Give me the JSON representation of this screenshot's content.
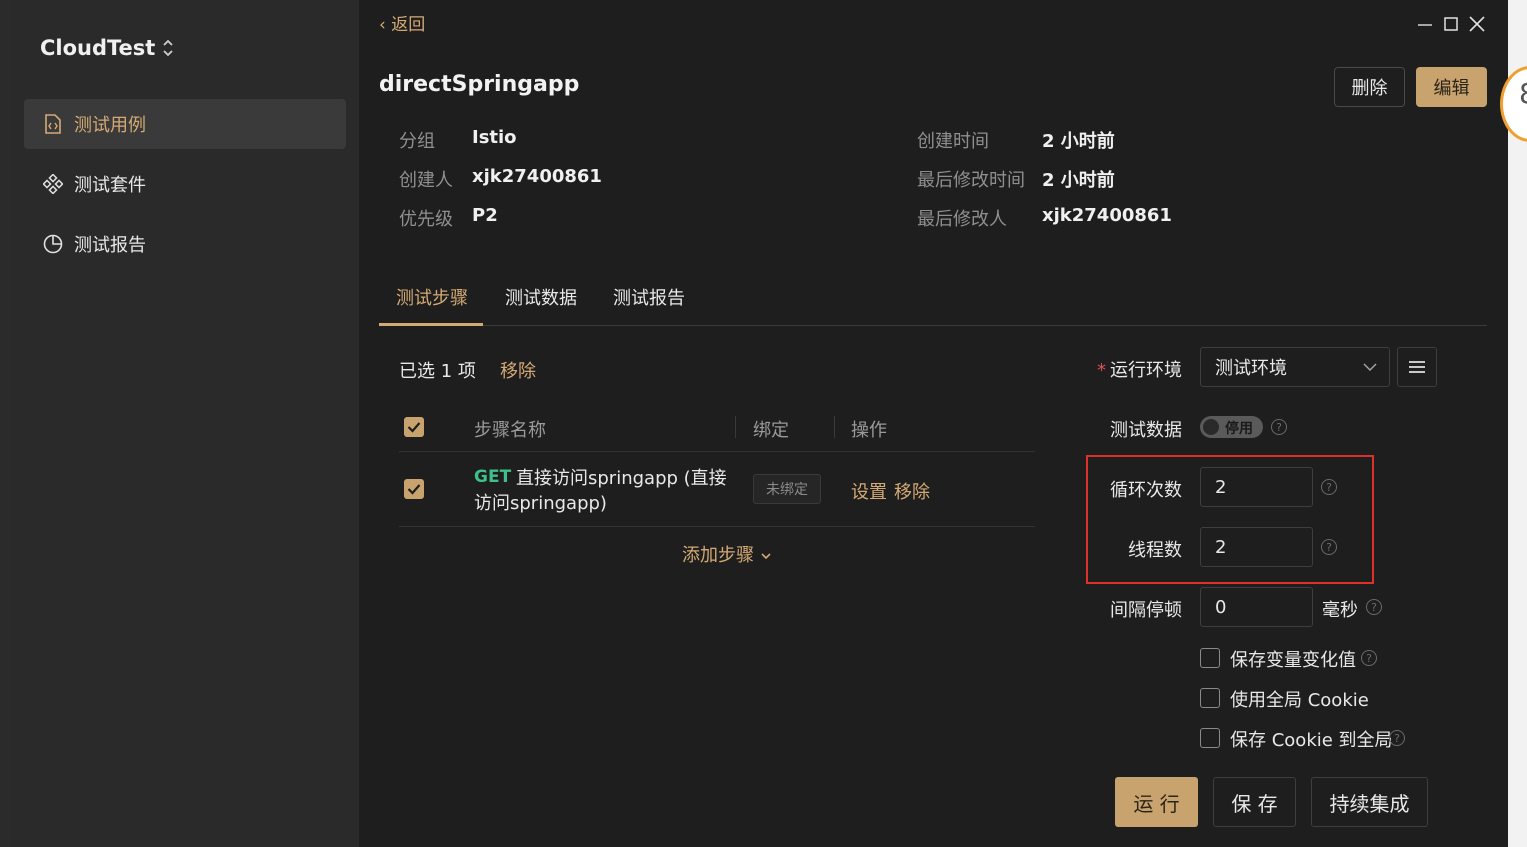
{
  "app": {
    "name": "CloudTest"
  },
  "sidebar": {
    "items": [
      {
        "label": "测试用例",
        "icon": "file-code-icon",
        "active": true
      },
      {
        "label": "测试套件",
        "icon": "components-icon",
        "active": false
      },
      {
        "label": "测试报告",
        "icon": "pie-chart-icon",
        "active": false
      }
    ]
  },
  "header": {
    "back_label": "返回",
    "title": "directSpringapp",
    "delete_label": "删除",
    "edit_label": "编辑",
    "window_controls": [
      "minimize-icon",
      "maximize-icon",
      "close-icon"
    ]
  },
  "meta": {
    "group_label": "分组",
    "group_value": "Istio",
    "creator_label": "创建人",
    "creator_value": "xjk27400861",
    "priority_label": "优先级",
    "priority_value": "P2",
    "created_label": "创建时间",
    "created_value": "2 小时前",
    "modified_label": "最后修改时间",
    "modified_value": "2 小时前",
    "modifier_label": "最后修改人",
    "modifier_value": "xjk27400861"
  },
  "tabs": [
    {
      "label": "测试步骤",
      "active": true
    },
    {
      "label": "测试数据",
      "active": false
    },
    {
      "label": "测试报告",
      "active": false
    }
  ],
  "steps": {
    "selected_info": "已选 1 项",
    "remove_label": "移除",
    "columns": [
      "步骤名称",
      "绑定",
      "操作"
    ],
    "rows": [
      {
        "method": "GET",
        "name": "直接访问springapp (直接访问springapp)",
        "binding": "未绑定",
        "actions": [
          "设置",
          "移除"
        ],
        "checked": true
      }
    ],
    "add_step_label": "添加步骤"
  },
  "config": {
    "env_label": "运行环境",
    "env_value": "测试环境",
    "test_data_label": "测试数据",
    "test_data_toggle": "停用",
    "loop_label": "循环次数",
    "loop_value": "2",
    "threads_label": "线程数",
    "threads_value": "2",
    "interval_label": "间隔停顿",
    "interval_value": "0",
    "interval_unit": "毫秒",
    "options": [
      {
        "label": "保存变量变化值",
        "checked": false,
        "help": true
      },
      {
        "label": "使用全局 Cookie",
        "checked": false,
        "help": false
      },
      {
        "label": "保存 Cookie 到全局",
        "checked": false,
        "help": true
      }
    ]
  },
  "actions": {
    "run_label": "运 行",
    "save_label": "保 存",
    "ci_label": "持续集成"
  },
  "colors": {
    "accent": "#c9a36e",
    "method_get": "#3fc08a",
    "highlight_box": "#e0302a"
  }
}
